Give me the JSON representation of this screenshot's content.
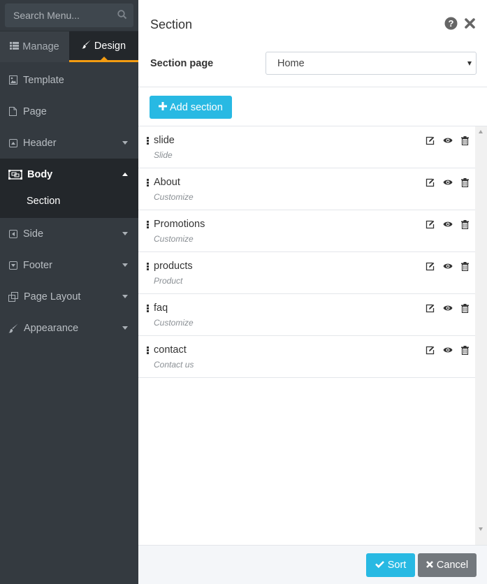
{
  "sidebar": {
    "search_placeholder": "Search Menu...",
    "tabs": [
      {
        "label": "Manage",
        "icon": "list-icon",
        "active": false
      },
      {
        "label": "Design",
        "icon": "brush-icon",
        "active": true
      }
    ],
    "items": [
      {
        "label": "Template",
        "icon": "image-icon"
      },
      {
        "label": "Page",
        "icon": "file-icon"
      },
      {
        "label": "Header",
        "icon": "caret-square-up-icon"
      },
      {
        "label": "Body",
        "icon": "object-group-icon"
      },
      {
        "label": "Section"
      },
      {
        "label": "Side",
        "icon": "caret-square-left-icon"
      },
      {
        "label": "Footer",
        "icon": "caret-square-down-icon"
      },
      {
        "label": "Page Layout",
        "icon": "clone-icon"
      },
      {
        "label": "Appearance",
        "icon": "paint-brush-icon"
      }
    ]
  },
  "panel": {
    "title": "Section",
    "page_label": "Section page",
    "page_value": "Home",
    "add_label": "Add section"
  },
  "sections": [
    {
      "name": "slide",
      "type": "Slide"
    },
    {
      "name": "About",
      "type": "Customize"
    },
    {
      "name": "Promotions",
      "type": "Customize"
    },
    {
      "name": "products",
      "type": "Product"
    },
    {
      "name": "faq",
      "type": "Customize"
    },
    {
      "name": "contact",
      "type": "Contact us"
    }
  ],
  "footer": {
    "sort_label": "Sort",
    "cancel_label": "Cancel"
  },
  "colors": {
    "sidebar_bg": "#343a40",
    "accent": "#f39c12",
    "primary": "#28b9e3",
    "secondary": "#73787d"
  }
}
